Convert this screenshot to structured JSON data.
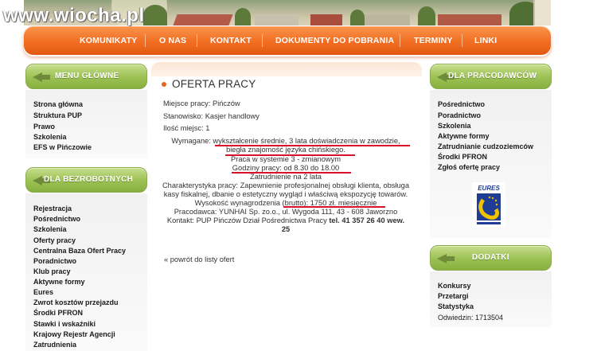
{
  "header": {
    "logo_text": "www.wiocha.pl",
    "nav": [
      "KOMUNIKATY",
      "O NAS",
      "KONTAKT",
      "DOKUMENTY DO POBRANIA",
      "TERMINY",
      "LINKI"
    ]
  },
  "left": {
    "menu_title": "MENU GŁÓWNE",
    "menu_items": [
      "Strona główna",
      "Struktura PUP",
      "Prawo",
      "Szkolenia",
      "EFS w Pińczowie"
    ],
    "unemployed_title": "DLA BEZROBOTNYCH",
    "unemployed_items": [
      "Rejestracja",
      "Pośrednictwo",
      "Szkolenia",
      "Oferty pracy",
      "Centralna Baza Ofert Pracy",
      "Poradnictwo",
      "Klub pracy",
      "Aktywne formy",
      "Eures",
      "Zwrot kosztów przejazdu",
      "Środki PFRON",
      "Stawki i wskaźniki",
      "Krajowy Rejestr Agencji",
      "Zatrudnienia"
    ]
  },
  "right": {
    "employers_title": "DLA PRACODAWCÓW",
    "employers_items": [
      "Pośrednictwo",
      "Poradnictwo",
      "Szkolenia",
      "Aktywne formy",
      "Zatrudnianie cudzoziemców",
      "Środki PFRON",
      "Zgłoś ofertę pracy"
    ],
    "eures_label": "EURES",
    "extras_title": "DODATKI",
    "extras_items": [
      "Konkursy",
      "Przetargi",
      "Statystyka"
    ],
    "visits_text": "Odwiedzin: 1713504"
  },
  "offer": {
    "title": "OFERTA PRACY",
    "place": "Miejsce pracy: Pińczów",
    "position": "Stanowisko: Kasjer handlowy",
    "count": "Ilość miejsc: 1",
    "req1": "Wymagane: wykształcenie średnie, 3 lata doświadczenia w zawodzie,",
    "req2": "biegła znajomość języka chińskiego.",
    "shift1": "Praca w systemie 3 - zmianowym",
    "shift2": "Godziny pracy: od 8.30  do 18.00",
    "contract": "Zatrudnienie na 2 lata",
    "char1": "Charakterystyka pracy: Zapewnienie profesjonalnej obsługi klienta, obsługa",
    "char2": "kasy fiskalnej, dbanie o estetyczny wygląd i właściwą ekspozycję towarów.",
    "salary": "Wysokość wynagrodzenia (brutto): 1750 zł. miesięcznie",
    "employer": "Pracodawca: YUNHAI Sp. zo.o., ul. Wygoda 111, 43 - 608 Jaworzno",
    "contact_prefix": "Kontakt: PUP Pińczów Dział Pośrednictwa Pracy ",
    "contact_phone": "tel. 41 357 26 40 wew.",
    "contact_ext": "25",
    "back": "« powrót do listy ofert"
  },
  "colors": {
    "nav_orange": "#f26d21",
    "box_green": "#9ec357",
    "highlight_red": "#d8122a"
  }
}
